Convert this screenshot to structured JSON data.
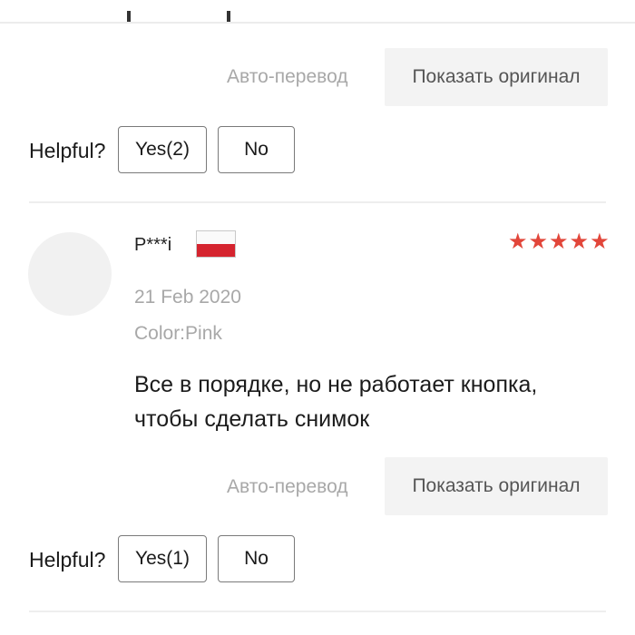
{
  "review_prev": {
    "auto_translate": "Авто-перевод",
    "show_original": "Показать оригинал",
    "helpful_label": "Helpful?",
    "yes_label": "Yes(2)",
    "no_label": "No"
  },
  "review": {
    "username": "P***i",
    "flag_icon": "poland-flag-icon",
    "rating": 5,
    "stars": "★★★★★",
    "star_color": "#e2463a",
    "date": "21 Feb 2020",
    "color_attr": "Color:Pink",
    "text_line1": "Все в порядке, но не работает кнопка,",
    "text_line2": "чтобы сделать снимок",
    "auto_translate": "Авто-перевод",
    "show_original": "Показать оригинал",
    "helpful_label": "Helpful?",
    "yes_label": "Yes(1)",
    "no_label": "No"
  }
}
